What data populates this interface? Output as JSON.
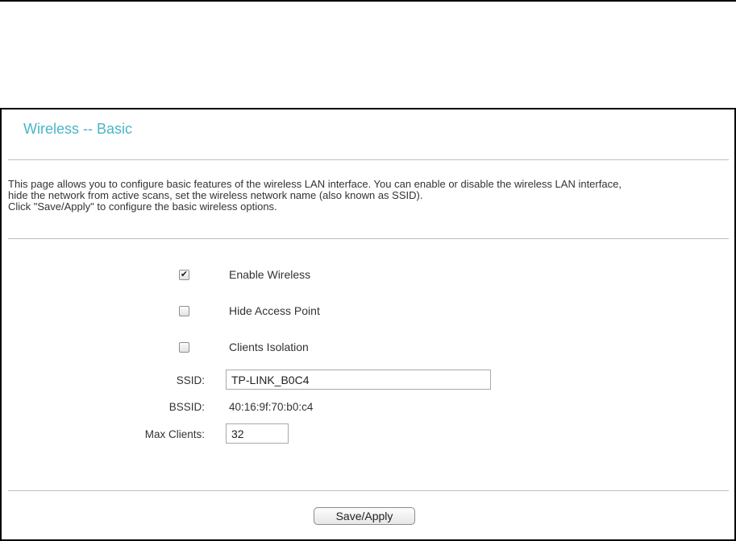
{
  "page": {
    "title": "Wireless -- Basic",
    "description_lines": [
      "This page allows you to configure basic features of the wireless LAN interface. You can enable or disable the wireless LAN interface,",
      "hide the network from active scans, set the wireless network name (also known as SSID).",
      "Click \"Save/Apply\" to configure the basic wireless options."
    ]
  },
  "options": [
    {
      "label": "Enable Wireless",
      "checked": true
    },
    {
      "label": "Hide Access Point",
      "checked": false
    },
    {
      "label": "Clients Isolation",
      "checked": false
    }
  ],
  "fields": {
    "ssid_label": "SSID:",
    "ssid_value": "TP-LINK_B0C4",
    "bssid_label": "BSSID:",
    "bssid_value": "40:16:9f:70:b0:c4",
    "max_clients_label": "Max Clients:",
    "max_clients_value": "32"
  },
  "actions": {
    "save_label": "Save/Apply"
  },
  "colors": {
    "title": "#4ab5c8",
    "rule": "#bdbdbd"
  },
  "icons": {
    "checkmark": "check-icon"
  }
}
